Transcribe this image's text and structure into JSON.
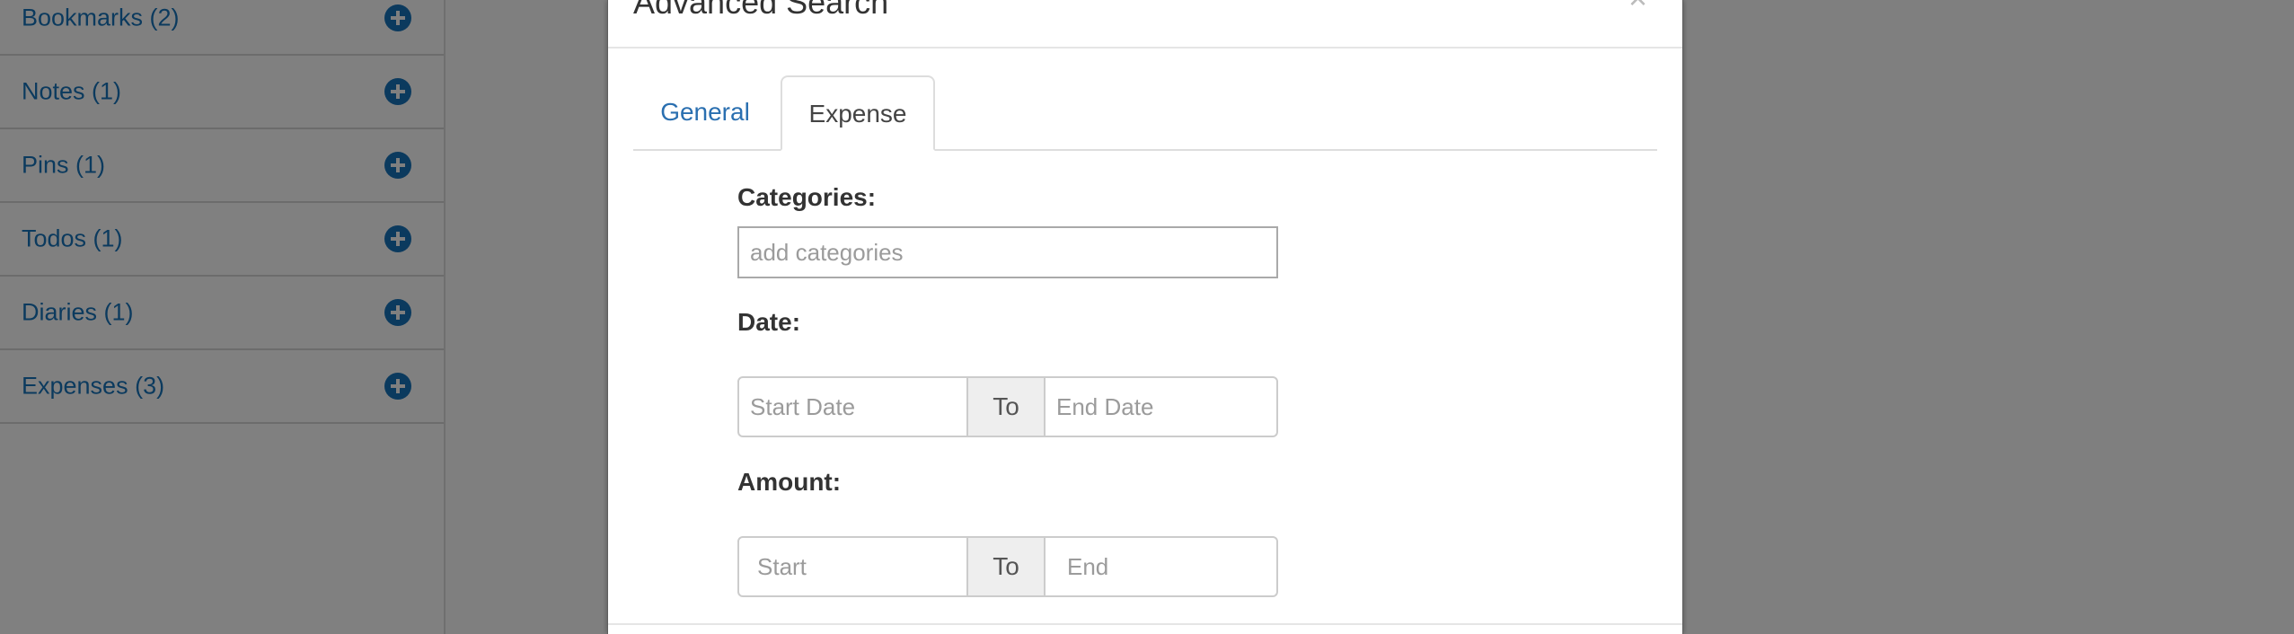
{
  "sidebar": {
    "items": [
      {
        "label": "Bookmarks (2)"
      },
      {
        "label": "Notes (1)"
      },
      {
        "label": "Pins (1)"
      },
      {
        "label": "Todos (1)"
      },
      {
        "label": "Diaries (1)"
      },
      {
        "label": "Expenses (3)"
      }
    ]
  },
  "modal": {
    "title": "Advanced Search",
    "close_glyph": "×",
    "tabs": [
      {
        "label": "General",
        "active": false
      },
      {
        "label": "Expense",
        "active": true
      }
    ],
    "categories": {
      "label": "Categories:",
      "placeholder": "add categories"
    },
    "date": {
      "label": "Date:",
      "start_placeholder": "Start Date",
      "separator": "To",
      "end_placeholder": "End Date"
    },
    "amount": {
      "label": "Amount:",
      "start_placeholder": "Start",
      "separator": "To",
      "end_placeholder": "End"
    }
  },
  "colors": {
    "link": "#2a6fb0",
    "overlay": "#7f7f7f",
    "sidebar_text_dimmed": "#0b3a5e"
  },
  "icons": {
    "sidebar_add": "plus-circle-icon",
    "modal_close": "close-icon"
  }
}
